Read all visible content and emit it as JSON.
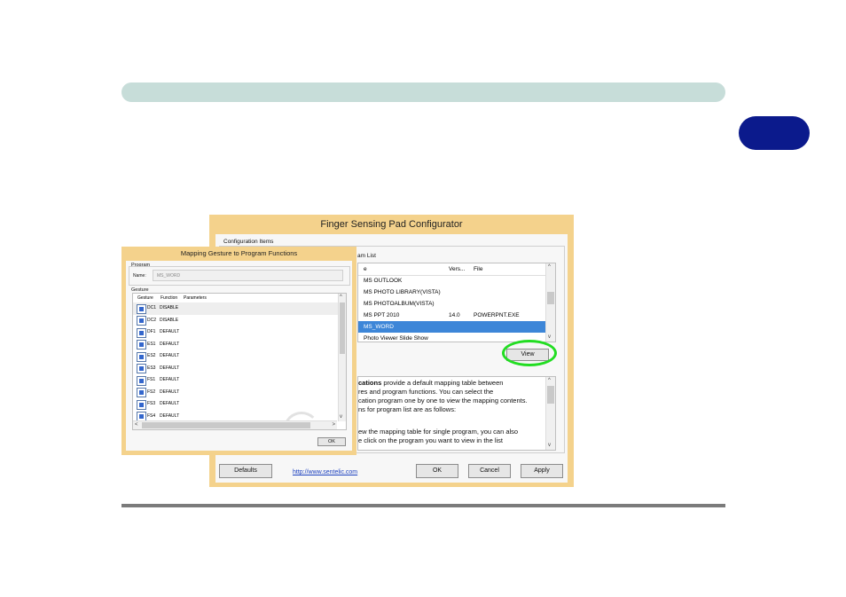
{
  "page": {
    "header_bar_color": "#c7ddd9",
    "tab_badge_color": "#0b1a8c",
    "footer_line_color": "#7b7b7b"
  },
  "main_dialog": {
    "title": "Finger Sensing Pad Configurator",
    "configuration_items_label": "Configuration Items",
    "program_list_label": "am List",
    "columns": [
      "e",
      "Vers...",
      "File"
    ],
    "rows": [
      {
        "name": "MS OUTLOOK",
        "version": "",
        "file": "",
        "selected": false
      },
      {
        "name": "MS PHOTO LIBRARY(VISTA)",
        "version": "",
        "file": "",
        "selected": false
      },
      {
        "name": "MS PHOTOALBUM(VISTA)",
        "version": "",
        "file": "",
        "selected": false
      },
      {
        "name": "MS PPT 2010",
        "version": "14.0",
        "file": "POWERPNT.EXE",
        "selected": false
      },
      {
        "name": "MS_WORD",
        "version": "",
        "file": "",
        "selected": true
      },
      {
        "name": "Photo Viewer Slide Show",
        "version": "",
        "file": "",
        "selected": false
      }
    ],
    "view_button": "View",
    "description_lines": [
      {
        "bold": "cations",
        "text": " provide a default mapping table between"
      },
      {
        "bold": "",
        "text": "res and program functions. You can select the"
      },
      {
        "bold": "",
        "text": "cation program one by one to view the mapping contents."
      },
      {
        "bold": "",
        "text": "ns for program list are as follows:"
      },
      {
        "bold": "",
        "text": "ew the mapping table for single program, you can also"
      },
      {
        "bold": "",
        "text": "e click on the program you want to view in the list"
      }
    ],
    "defaults_button": "Defaults",
    "link": "http://www.sentelic.com",
    "ok_button": "OK",
    "cancel_button": "Cancel",
    "apply_button": "Apply",
    "highlight_color": "#22dd22",
    "selection_color": "#3d86d8"
  },
  "gesture_dialog": {
    "title": "Mapping Gesture to Program Functions",
    "program_group": "Program",
    "name_label": "Name:",
    "name_value": "MS_WORD",
    "gesture_group": "Gesture",
    "columns": [
      "Gesture",
      "Function",
      "Parameters"
    ],
    "rows": [
      {
        "code": "DC1",
        "function": "DISABLE"
      },
      {
        "code": "DC2",
        "function": "DISABLE"
      },
      {
        "code": "DF1",
        "function": "DEFAULT"
      },
      {
        "code": "ES1",
        "function": "DEFAULT"
      },
      {
        "code": "ES2",
        "function": "DEFAULT"
      },
      {
        "code": "ES3",
        "function": "DEFAULT"
      },
      {
        "code": "FS1",
        "function": "DEFAULT"
      },
      {
        "code": "FS2",
        "function": "DEFAULT"
      },
      {
        "code": "FS3",
        "function": "DEFAULT"
      },
      {
        "code": "FS4",
        "function": "DEFAULT"
      }
    ],
    "ok_button": "OK"
  }
}
